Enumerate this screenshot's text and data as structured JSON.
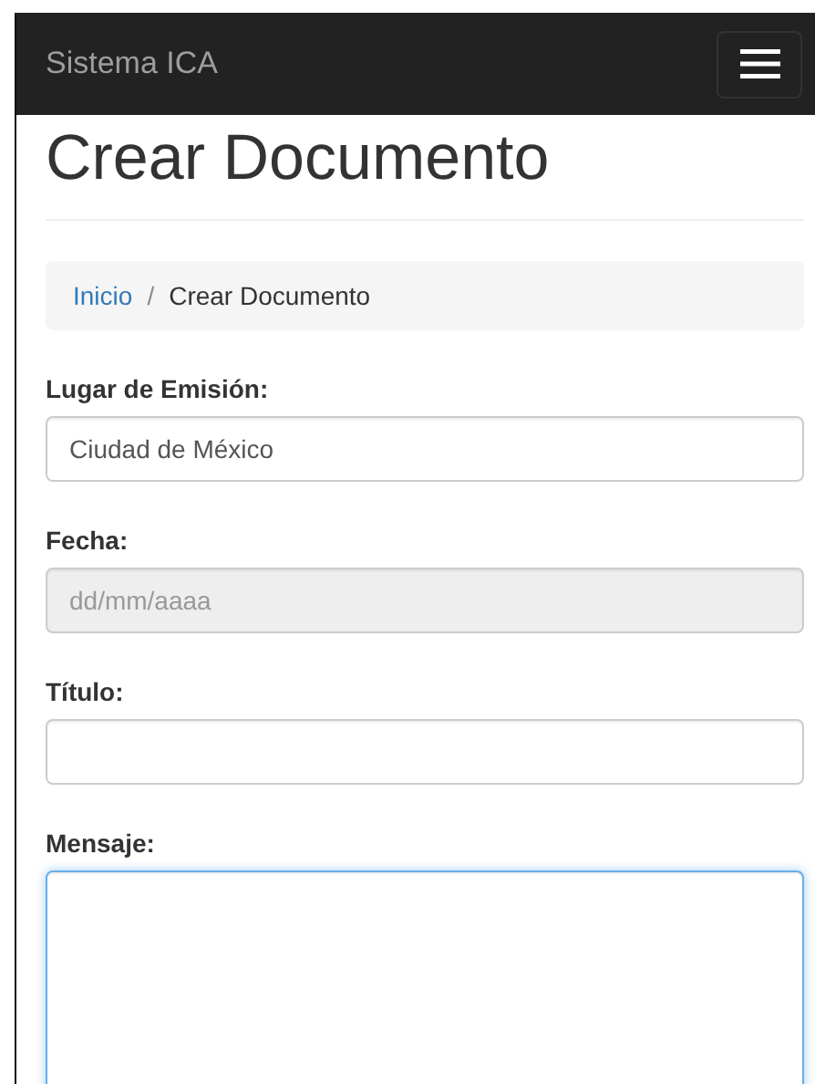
{
  "navbar": {
    "brand": "Sistema ICA"
  },
  "page_title": "Crear Documento",
  "breadcrumb_separator": "/",
  "breadcrumb": [
    {
      "label": "Inicio",
      "kind": "link"
    },
    {
      "label": "Crear Documento",
      "kind": "current"
    }
  ],
  "fields": [
    {
      "label": "Lugar de Emisión:",
      "kind": "input",
      "value": "Ciudad de México",
      "disabled": false,
      "focused": false
    },
    {
      "label": "Fecha:",
      "kind": "input",
      "placeholder": "dd/mm/aaaa",
      "disabled": true,
      "focused": false
    },
    {
      "label": "Título:",
      "kind": "input",
      "disabled": false,
      "focused": false
    },
    {
      "label": "Mensaje:",
      "kind": "textarea",
      "disabled": false,
      "focused": true
    }
  ]
}
